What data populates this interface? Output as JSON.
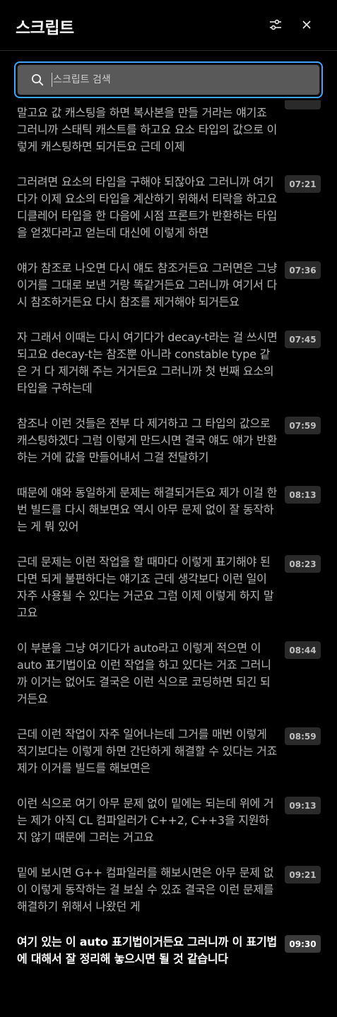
{
  "header": {
    "title": "스크립트",
    "filter_icon": "sliders-icon",
    "close_icon": "close-icon"
  },
  "search": {
    "placeholder": "스크립트 검색",
    "value": ""
  },
  "segments": [
    {
      "text": "말고요 값 캐스팅을 하면 복사본을 만들 거라는 얘기죠 그러니까 스태틱 캐스트를 하고요 요소 타입의 값으로 이렇게 캐스팅하면 되거든요 근데 이제",
      "time": ""
    },
    {
      "text": "그러려면 요소의 타입을 구해야 되잖아요 그러니까 여기다가 이제 요소의 타입을 계산하기 위해서 티락을 하고요 디클레어 타입을 한 다음에 시점 프론트가 반환하는 타입을 얻겠다라고 얻는데 대신에 이렇게 하면",
      "time": "07:21"
    },
    {
      "text": "얘가 참조로 나오면 다시 얘도 참조거든요 그러면은 그냥 이거를 그대로 보낸 거랑 똑같거든요 그러니까 여기서 다시 참조하거든요 다시 참조를 제거해야 되거든요",
      "time": "07:36"
    },
    {
      "text": "자 그래서 이때는 다시 여기다가 decay-t라는 걸 쓰시면 되고요 decay-t는 참조뿐 아니라 constable type 같은 거 다 제거해 주는 거거든요 그러니까 첫 번째 요소의 타입을 구하는데",
      "time": "07:45"
    },
    {
      "text": "참조나 이런 것들은 전부 다 제거하고 그 타입의 값으로 캐스팅하겠다 그럼 이렇게 만드시면 결국 얘도 얘가 반환하는 거에 값을 만들어내서 그걸 전달하기",
      "time": "07:59"
    },
    {
      "text": "때문에 얘와 동일하게 문제는 해결되거든요 제가 이걸 한번 빌드를 다시 해보면요 역시 아무 문제 없이 잘 동작하는 게 뭐 있어",
      "time": "08:13"
    },
    {
      "text": "근데 문제는 이런 작업을 할 때마다 이렇게 표기해야 된다면 되게 불편하다는 얘기죠 근데 생각보다 이런 일이 자주 사용될 수 있다는 거군요 그럼 이제 이렇게 하지 말고요",
      "time": "08:23"
    },
    {
      "text": "이 부분을 그냥 여기다가 auto라고 이렇게 적으면 이 auto 표기법이요 이런 작업을 하고 있다는 거죠 그러니까 이거는 없어도 결국은 이런 식으로 코딩하면 되긴 되거든요",
      "time": "08:44"
    },
    {
      "text": "근데 이런 작업이 자주 일어나는데 그거를 매번 이렇게 적기보다는 이렇게 하면 간단하게 해결할 수 있다는 거죠 제가 이거를 빌드를 해보면은",
      "time": "08:59"
    },
    {
      "text": "이런 식으로 여기 아무 문제 없이 밑에는 되는데 위에 거는 제가 아직 CL 컴파일러가 C++2, C++3을 지원하지 않기 때문에 그러는 거고요",
      "time": "09:13"
    },
    {
      "text": "밑에 보시면 G++ 컴파일러를 해보시면은 아무 문제 없이 이렇게 동작하는 걸 보실 수 있죠 결국은 이런 문제를 해결하기 위해서 나왔던 게",
      "time": "09:21"
    },
    {
      "text": "여기 있는 이 auto 표기법이거든요 그러니까 이 표기법에 대해서 잘 정리해 놓으시면 될 것 같습니다",
      "time": "09:30",
      "active": true
    }
  ]
}
